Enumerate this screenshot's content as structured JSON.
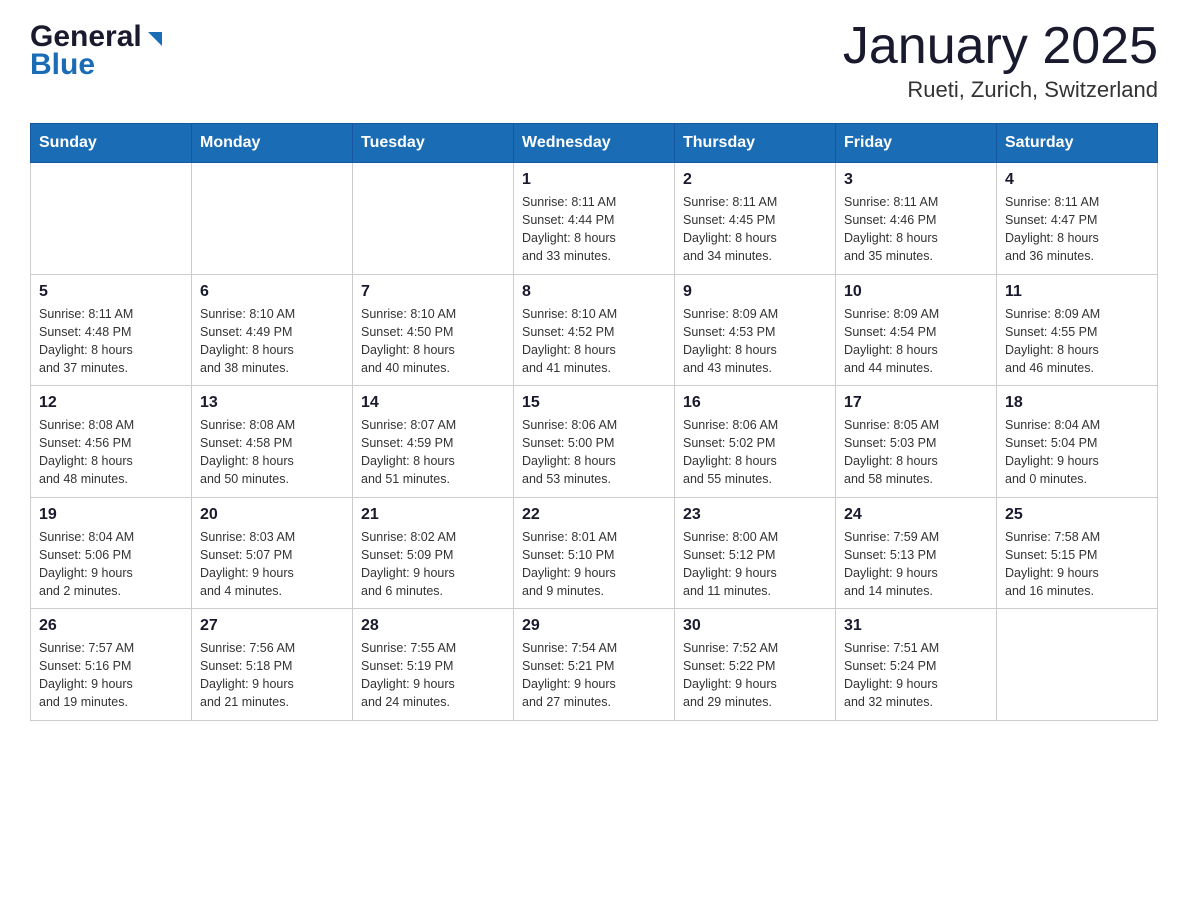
{
  "header": {
    "logo_general": "General",
    "logo_blue": "Blue",
    "month_title": "January 2025",
    "location": "Rueti, Zurich, Switzerland"
  },
  "days_of_week": [
    "Sunday",
    "Monday",
    "Tuesday",
    "Wednesday",
    "Thursday",
    "Friday",
    "Saturday"
  ],
  "weeks": [
    [
      {
        "day": "",
        "info": ""
      },
      {
        "day": "",
        "info": ""
      },
      {
        "day": "",
        "info": ""
      },
      {
        "day": "1",
        "info": "Sunrise: 8:11 AM\nSunset: 4:44 PM\nDaylight: 8 hours\nand 33 minutes."
      },
      {
        "day": "2",
        "info": "Sunrise: 8:11 AM\nSunset: 4:45 PM\nDaylight: 8 hours\nand 34 minutes."
      },
      {
        "day": "3",
        "info": "Sunrise: 8:11 AM\nSunset: 4:46 PM\nDaylight: 8 hours\nand 35 minutes."
      },
      {
        "day": "4",
        "info": "Sunrise: 8:11 AM\nSunset: 4:47 PM\nDaylight: 8 hours\nand 36 minutes."
      }
    ],
    [
      {
        "day": "5",
        "info": "Sunrise: 8:11 AM\nSunset: 4:48 PM\nDaylight: 8 hours\nand 37 minutes."
      },
      {
        "day": "6",
        "info": "Sunrise: 8:10 AM\nSunset: 4:49 PM\nDaylight: 8 hours\nand 38 minutes."
      },
      {
        "day": "7",
        "info": "Sunrise: 8:10 AM\nSunset: 4:50 PM\nDaylight: 8 hours\nand 40 minutes."
      },
      {
        "day": "8",
        "info": "Sunrise: 8:10 AM\nSunset: 4:52 PM\nDaylight: 8 hours\nand 41 minutes."
      },
      {
        "day": "9",
        "info": "Sunrise: 8:09 AM\nSunset: 4:53 PM\nDaylight: 8 hours\nand 43 minutes."
      },
      {
        "day": "10",
        "info": "Sunrise: 8:09 AM\nSunset: 4:54 PM\nDaylight: 8 hours\nand 44 minutes."
      },
      {
        "day": "11",
        "info": "Sunrise: 8:09 AM\nSunset: 4:55 PM\nDaylight: 8 hours\nand 46 minutes."
      }
    ],
    [
      {
        "day": "12",
        "info": "Sunrise: 8:08 AM\nSunset: 4:56 PM\nDaylight: 8 hours\nand 48 minutes."
      },
      {
        "day": "13",
        "info": "Sunrise: 8:08 AM\nSunset: 4:58 PM\nDaylight: 8 hours\nand 50 minutes."
      },
      {
        "day": "14",
        "info": "Sunrise: 8:07 AM\nSunset: 4:59 PM\nDaylight: 8 hours\nand 51 minutes."
      },
      {
        "day": "15",
        "info": "Sunrise: 8:06 AM\nSunset: 5:00 PM\nDaylight: 8 hours\nand 53 minutes."
      },
      {
        "day": "16",
        "info": "Sunrise: 8:06 AM\nSunset: 5:02 PM\nDaylight: 8 hours\nand 55 minutes."
      },
      {
        "day": "17",
        "info": "Sunrise: 8:05 AM\nSunset: 5:03 PM\nDaylight: 8 hours\nand 58 minutes."
      },
      {
        "day": "18",
        "info": "Sunrise: 8:04 AM\nSunset: 5:04 PM\nDaylight: 9 hours\nand 0 minutes."
      }
    ],
    [
      {
        "day": "19",
        "info": "Sunrise: 8:04 AM\nSunset: 5:06 PM\nDaylight: 9 hours\nand 2 minutes."
      },
      {
        "day": "20",
        "info": "Sunrise: 8:03 AM\nSunset: 5:07 PM\nDaylight: 9 hours\nand 4 minutes."
      },
      {
        "day": "21",
        "info": "Sunrise: 8:02 AM\nSunset: 5:09 PM\nDaylight: 9 hours\nand 6 minutes."
      },
      {
        "day": "22",
        "info": "Sunrise: 8:01 AM\nSunset: 5:10 PM\nDaylight: 9 hours\nand 9 minutes."
      },
      {
        "day": "23",
        "info": "Sunrise: 8:00 AM\nSunset: 5:12 PM\nDaylight: 9 hours\nand 11 minutes."
      },
      {
        "day": "24",
        "info": "Sunrise: 7:59 AM\nSunset: 5:13 PM\nDaylight: 9 hours\nand 14 minutes."
      },
      {
        "day": "25",
        "info": "Sunrise: 7:58 AM\nSunset: 5:15 PM\nDaylight: 9 hours\nand 16 minutes."
      }
    ],
    [
      {
        "day": "26",
        "info": "Sunrise: 7:57 AM\nSunset: 5:16 PM\nDaylight: 9 hours\nand 19 minutes."
      },
      {
        "day": "27",
        "info": "Sunrise: 7:56 AM\nSunset: 5:18 PM\nDaylight: 9 hours\nand 21 minutes."
      },
      {
        "day": "28",
        "info": "Sunrise: 7:55 AM\nSunset: 5:19 PM\nDaylight: 9 hours\nand 24 minutes."
      },
      {
        "day": "29",
        "info": "Sunrise: 7:54 AM\nSunset: 5:21 PM\nDaylight: 9 hours\nand 27 minutes."
      },
      {
        "day": "30",
        "info": "Sunrise: 7:52 AM\nSunset: 5:22 PM\nDaylight: 9 hours\nand 29 minutes."
      },
      {
        "day": "31",
        "info": "Sunrise: 7:51 AM\nSunset: 5:24 PM\nDaylight: 9 hours\nand 32 minutes."
      },
      {
        "day": "",
        "info": ""
      }
    ]
  ]
}
